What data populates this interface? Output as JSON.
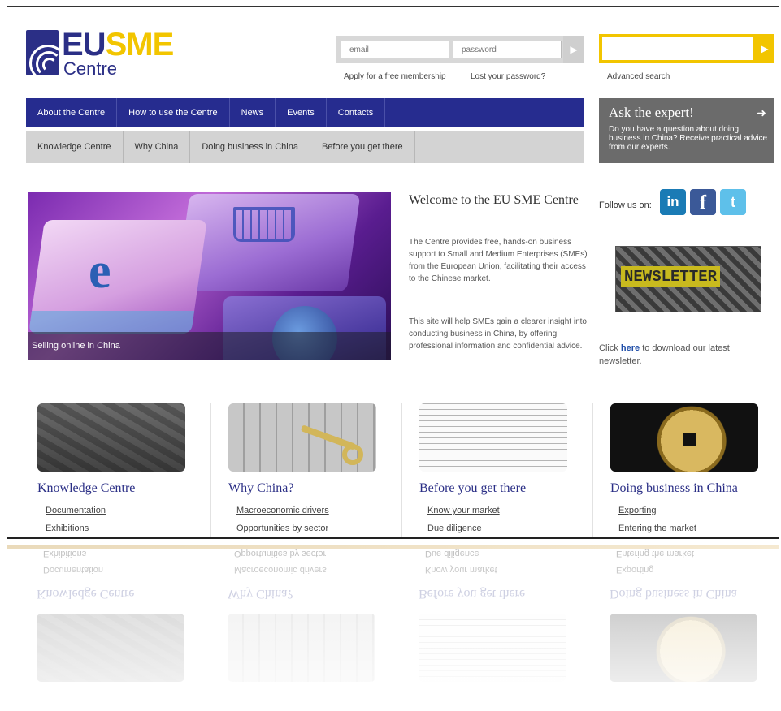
{
  "header": {
    "logo": {
      "eu": "EU",
      "sme": "SME",
      "centre": "Centre"
    },
    "login": {
      "email_placeholder": "email",
      "password_placeholder": "password",
      "apply_link": "Apply for a free membership",
      "lost_password_link": "Lost your password?"
    },
    "search": {
      "placeholder": "",
      "advanced_link": "Advanced search"
    }
  },
  "nav_primary": [
    "About the Centre",
    "How to use the Centre",
    "News",
    "Events",
    "Contacts"
  ],
  "nav_secondary": [
    "Knowledge Centre",
    "Why China",
    "Doing business in China",
    "Before you get there"
  ],
  "ask_expert": {
    "title": "Ask the expert!",
    "text": "Do you have a question about doing business in China? Receive practical advice from our experts."
  },
  "hero": {
    "caption": "Selling online in China"
  },
  "welcome": {
    "title": "Welcome to the EU SME Centre",
    "p1": "The Centre provides free, hands-on business support to Small and Medium Enterprises (SMEs) from the European Union, facilitating their access to the Chinese market.",
    "p2": "This site will help SMEs gain a clearer insight into conducting business in China, by offering professional information and confidential advice."
  },
  "social": {
    "label": "Follow us on:",
    "icons": [
      "linkedin-icon",
      "facebook-icon",
      "twitter-icon"
    ],
    "linkedin_text": "in",
    "facebook_text": "f",
    "twitter_text": "t"
  },
  "newsletter": {
    "image_word": "NEWSLETTER",
    "text_before": "Click ",
    "here": "here",
    "text_after": " to download our latest newsletter."
  },
  "columns": [
    {
      "title": "Knowledge Centre",
      "links": [
        "Documentation",
        "Exhibitions"
      ]
    },
    {
      "title": "Why China?",
      "links": [
        "Macroeconomic drivers",
        "Opportunities by sector"
      ]
    },
    {
      "title": "Before you get there",
      "links": [
        "Know your market",
        "Due diligence"
      ]
    },
    {
      "title": "Doing business in China",
      "links": [
        "Exporting",
        "Entering the market"
      ]
    }
  ],
  "colors": {
    "brand_blue": "#2b2f86",
    "brand_yellow": "#f2c500",
    "nav_blue": "#262c8f",
    "ask_gray": "#6b6b6b"
  }
}
